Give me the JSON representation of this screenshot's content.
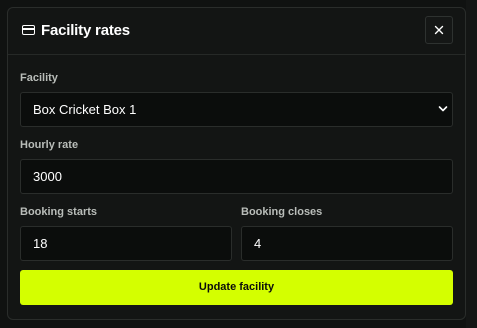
{
  "modal": {
    "title": "Facility rates",
    "title_icon": "card-icon",
    "close_icon": "close-icon"
  },
  "form": {
    "facility": {
      "label": "Facility",
      "selected": "Box Cricket Box 1",
      "chevron_icon": "chevron-down-icon"
    },
    "hourly_rate": {
      "label": "Hourly rate",
      "value": "3000"
    },
    "booking_starts": {
      "label": "Booking starts",
      "value": "18"
    },
    "booking_closes": {
      "label": "Booking closes",
      "value": "4"
    },
    "submit_label": "Update facility"
  },
  "colors": {
    "accent": "#d4ff00",
    "background": "#131514",
    "input_background": "#0b0d0c",
    "border": "#2a2d2b",
    "label": "#b9bdb9"
  }
}
